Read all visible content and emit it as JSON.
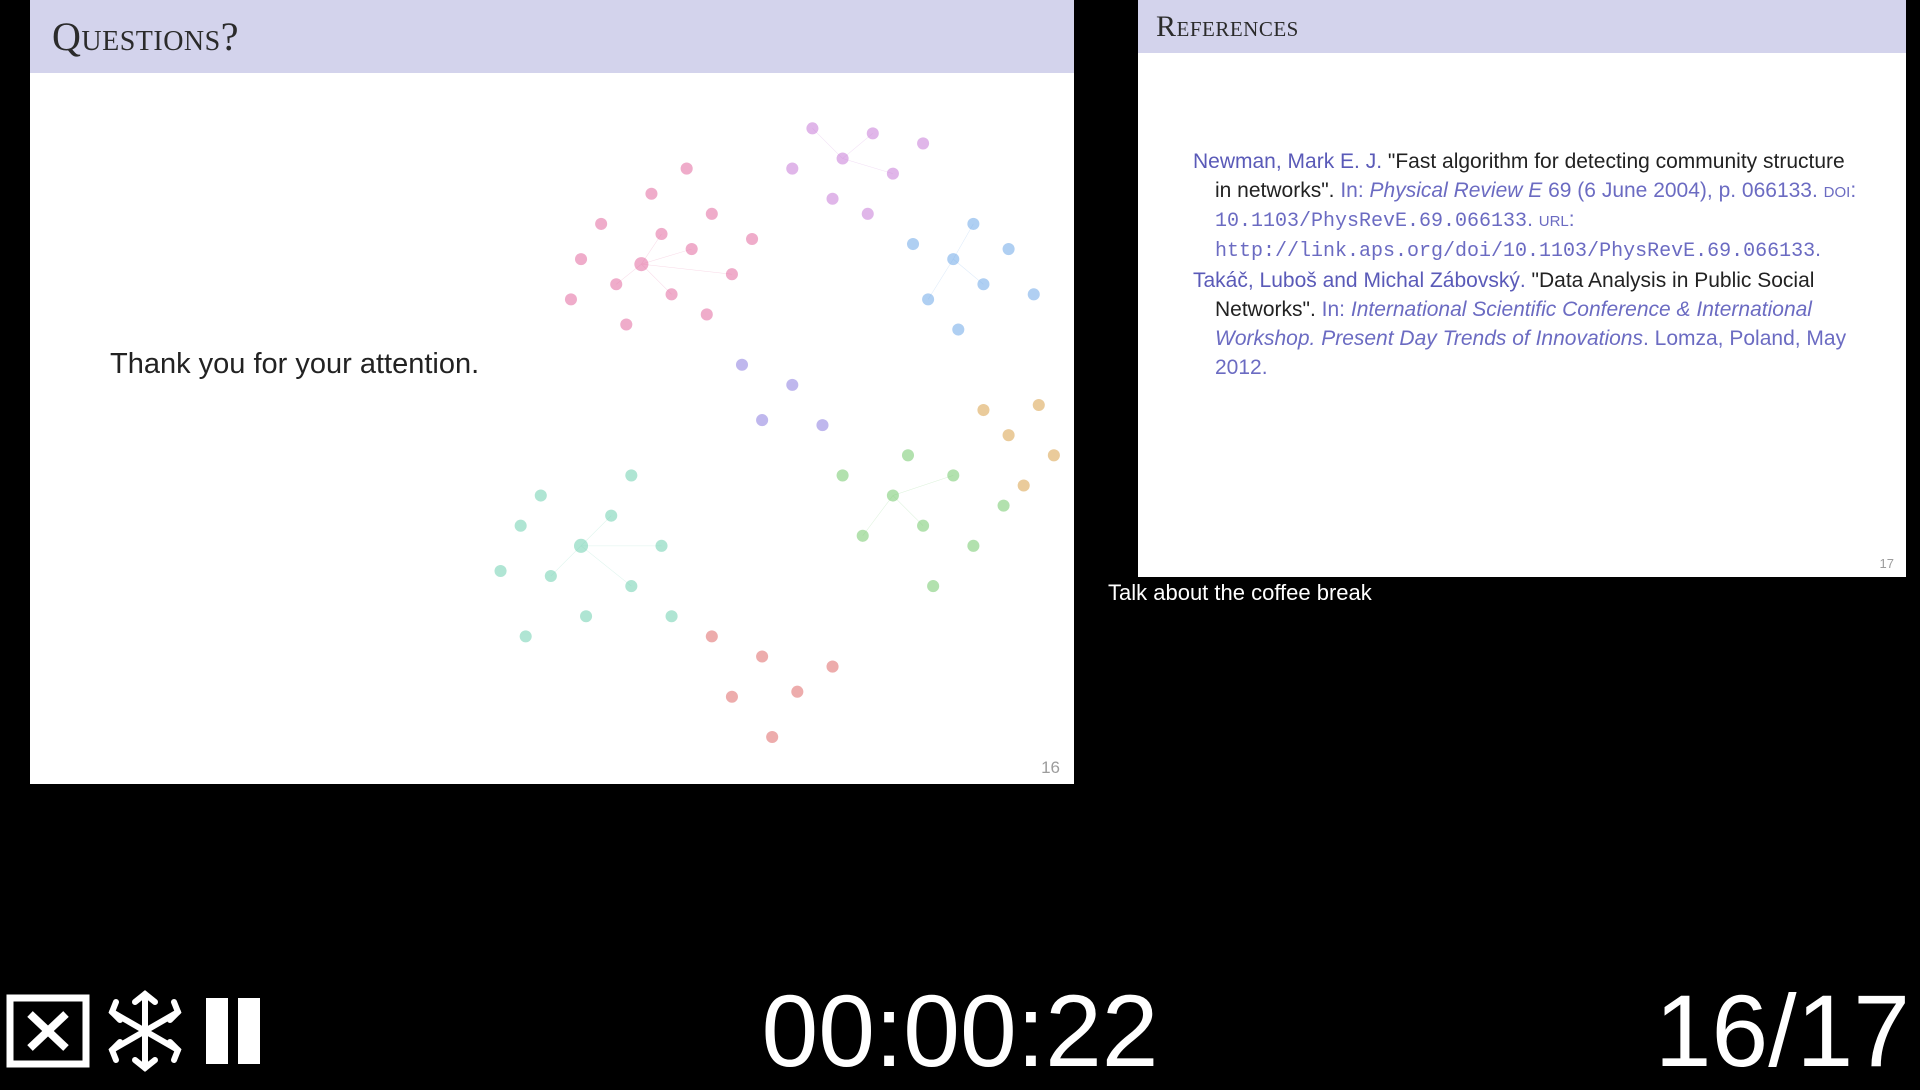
{
  "current_slide": {
    "title": "Questions?",
    "body_text": "Thank you for your attention.",
    "number": "16"
  },
  "next_slide": {
    "title": "References",
    "number": "17",
    "refs": [
      {
        "author": "Newman, Mark E. J.",
        "title": "\"Fast algorithm for detecting community structure in networks\".",
        "in": "In:",
        "venue": "Physical Review E",
        "vol": " 69 (6 June 2004), p. 066133. ",
        "doi_label": "doi",
        "doi": "10.1103/PhysRevE.69.066133",
        "url_label": "url",
        "url": "http://link.aps.org/doi/10.1103/PhysRevE.69.066133"
      },
      {
        "author": "Takáč, Luboš and Michal Zábovský.",
        "title": "\"Data Analysis in Public Social Networks\".",
        "in": "In:",
        "venue": "International Scientific Conference & International Workshop. Present Day Trends of Innovations",
        "tail": ". Lomza, Poland, May 2012."
      }
    ]
  },
  "notes": "Talk about the coffee break",
  "timer": "00:00:22",
  "page_current": "16",
  "page_total": "17",
  "icons": {
    "close": "close-icon",
    "freeze": "snowflake-icon",
    "pause": "pause-icon"
  }
}
